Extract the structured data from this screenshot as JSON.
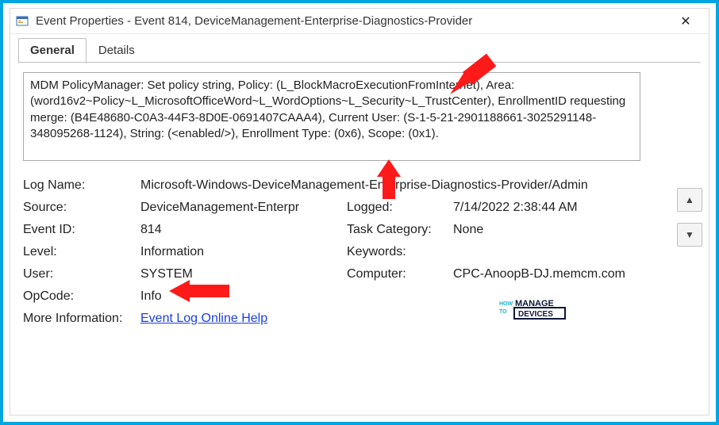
{
  "window": {
    "title": "Event Properties - Event 814, DeviceManagement-Enterprise-Diagnostics-Provider"
  },
  "tabs": {
    "general": "General",
    "details": "Details"
  },
  "description": "MDM PolicyManager: Set policy string, Policy: (L_BlockMacroExecutionFromInternet), Area: (word16v2~Policy~L_MicrosoftOfficeWord~L_WordOptions~L_Security~L_TrustCenter), EnrollmentID requesting merge: (B4E48680-C0A3-44F3-8D0E-0691407CAAA4), Current User: (S-1-5-21-2901188661-3025291148-348095268-1124), String: (<enabled/>), Enrollment Type: (0x6), Scope: (0x1).",
  "fields": {
    "log_name_label": "Log Name:",
    "log_name_value": "Microsoft-Windows-DeviceManagement-Enterprise-Diagnostics-Provider/Admin",
    "source_label": "Source:",
    "source_value": "DeviceManagement-Enterpr",
    "logged_label": "Logged:",
    "logged_value": "7/14/2022 2:38:44 AM",
    "event_id_label": "Event ID:",
    "event_id_value": "814",
    "task_category_label": "Task Category:",
    "task_category_value": "None",
    "level_label": "Level:",
    "level_value": "Information",
    "keywords_label": "Keywords:",
    "keywords_value": "",
    "user_label": "User:",
    "user_value": "SYSTEM",
    "computer_label": "Computer:",
    "computer_value": "CPC-AnoopB-DJ.memcm.com",
    "opcode_label": "OpCode:",
    "opcode_value": "Info",
    "more_info_label": "More Information:",
    "more_info_link": "Event Log Online Help"
  },
  "icons": {
    "close_glyph": "✕",
    "up_glyph": "▲",
    "down_glyph": "▼"
  },
  "annotations": {
    "arrow_color": "#ff1a1a"
  },
  "watermark": {
    "how": "HOW",
    "to": "TO",
    "manage": "MANAGE",
    "devices": "DEVICES"
  }
}
